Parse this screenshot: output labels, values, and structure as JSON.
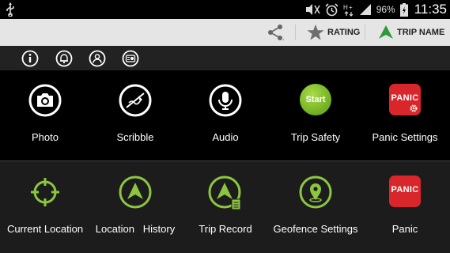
{
  "status_bar": {
    "battery": "96%",
    "time": "11:35"
  },
  "action_bar": {
    "share_icon": "share-icon",
    "rating_label": "RATING",
    "trip_name_label": "TRIP NAME"
  },
  "tabs": [
    "info-icon",
    "bell-icon",
    "person-icon",
    "settings-icon"
  ],
  "grid_top": [
    {
      "label": "Photo",
      "icon": "camera-icon"
    },
    {
      "label": "Scribble",
      "icon": "scribble-icon"
    },
    {
      "label": "Audio",
      "icon": "microphone-icon"
    },
    {
      "label": "Trip Safety",
      "icon": "start-button",
      "icon_text": "Start"
    },
    {
      "label": "Panic Settings",
      "icon": "panic-settings-icon",
      "icon_text": "PANIC"
    }
  ],
  "grid_bottom": [
    {
      "label": "Current Location",
      "icon": "crosshair-icon"
    },
    {
      "label": "Location   History",
      "icon": "navigation-icon"
    },
    {
      "label": "Trip Record",
      "icon": "trip-record-icon"
    },
    {
      "label": "Geofence Settings",
      "icon": "geofence-icon"
    },
    {
      "label": "Panic",
      "icon": "panic-icon",
      "icon_text": "PANIC"
    }
  ],
  "colors": {
    "accent_green": "#8cc63f",
    "panic_red": "#d8262b",
    "top_row_bg": "#000000",
    "bottom_row_bg": "#1c1c1c"
  }
}
